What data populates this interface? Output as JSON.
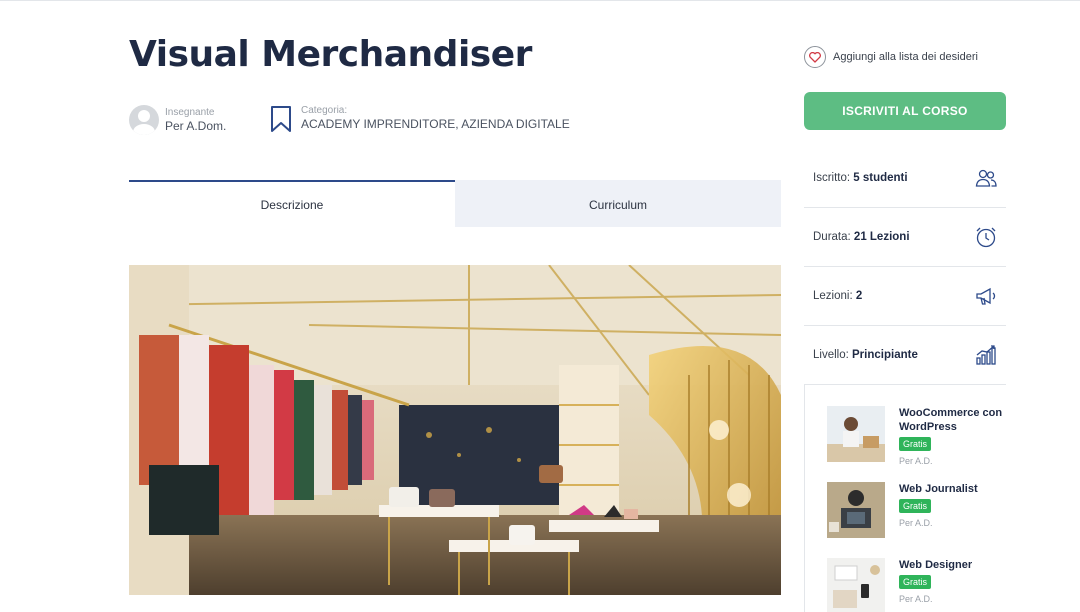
{
  "course": {
    "title": "Visual Merchandiser",
    "instructor_label": "Insegnante",
    "instructor_value": "Per A.Dom.",
    "category_label": "Categoria:",
    "category_value": "ACADEMY IMPRENDITORE, AZIENDA DIGITALE"
  },
  "tabs": [
    {
      "label": "Descrizione",
      "active": true
    },
    {
      "label": "Curriculum",
      "active": false
    }
  ],
  "sidebar": {
    "wishlist_label": "Aggiungi alla lista dei desideri",
    "enroll_label": "ISCRIVITI AL CORSO",
    "info": [
      {
        "label": "Iscritto:",
        "value": "5 studenti",
        "icon": "students-icon"
      },
      {
        "label": "Durata:",
        "value": "21 Lezioni",
        "icon": "clock-icon"
      },
      {
        "label": "Lezioni:",
        "value": "2",
        "icon": "megaphone-icon"
      },
      {
        "label": "Livello:",
        "value": "Principiante",
        "icon": "level-chart-icon"
      }
    ],
    "related_courses": [
      {
        "title": "WooCommerce con WordPress",
        "badge": "Gratis",
        "author": "Per A.D."
      },
      {
        "title": "Web Journalist",
        "badge": "Gratis",
        "author": "Per A.D."
      },
      {
        "title": "Web Designer",
        "badge": "Gratis",
        "author": "Per A.D."
      }
    ]
  },
  "colors": {
    "accent_green": "#5dbd83",
    "badge_green": "#2fb45a",
    "title_navy": "#1f2a44",
    "tab_active_border": "#2d4a8a",
    "tab_inactive_bg": "#eef1f7"
  }
}
